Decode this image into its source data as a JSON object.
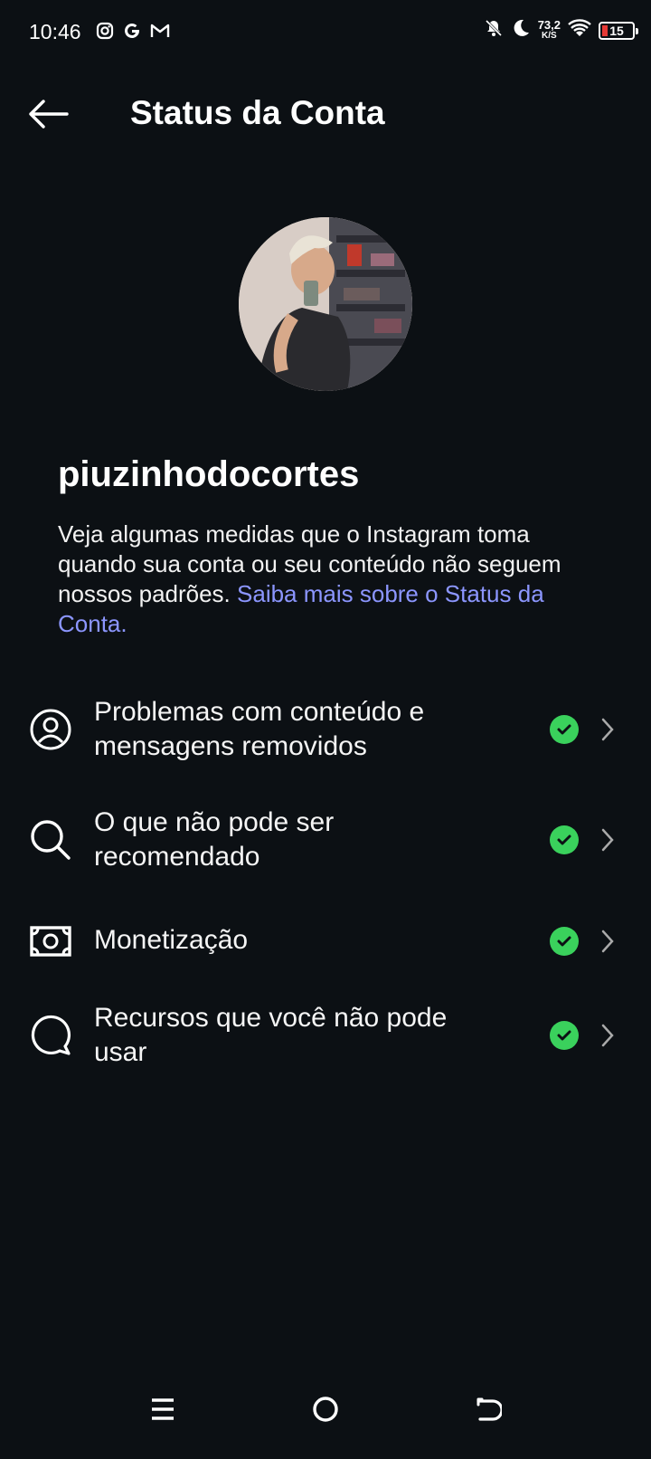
{
  "status_bar": {
    "time": "10:46",
    "speed_value": "73,2",
    "speed_unit": "K/S",
    "battery": "15",
    "icons": [
      "instagram-icon",
      "google-icon",
      "gmail-icon",
      "bell-off-icon",
      "moon-icon",
      "wifi-icon",
      "battery-icon"
    ]
  },
  "header": {
    "title": "Status da Conta",
    "back_icon": "back-arrow-icon"
  },
  "profile": {
    "username": "piuzinhodocortes",
    "description": "Veja algumas medidas que o Instagram toma quando sua conta ou seu conteúdo não seguem nossos padrões. ",
    "link_text": "Saiba mais sobre o Status da Conta."
  },
  "items": [
    {
      "label": "Problemas com conteúdo e mensagens removidos",
      "icon": "user-circle-icon",
      "status": "check-icon"
    },
    {
      "label": "O que não pode ser recomendado",
      "icon": "search-icon",
      "status": "check-icon"
    },
    {
      "label": "Monetização",
      "icon": "money-icon",
      "status": "check-icon"
    },
    {
      "label": "Recursos que você não pode usar",
      "icon": "speech-bubble-icon",
      "status": "check-icon"
    }
  ],
  "colors": {
    "background": "#0c1014",
    "link": "#8c96ff",
    "check": "#3ad15c",
    "battery_low": "#e53935"
  },
  "nav": {
    "buttons": [
      "menu-icon",
      "home-circle-icon",
      "back-nav-icon"
    ]
  }
}
